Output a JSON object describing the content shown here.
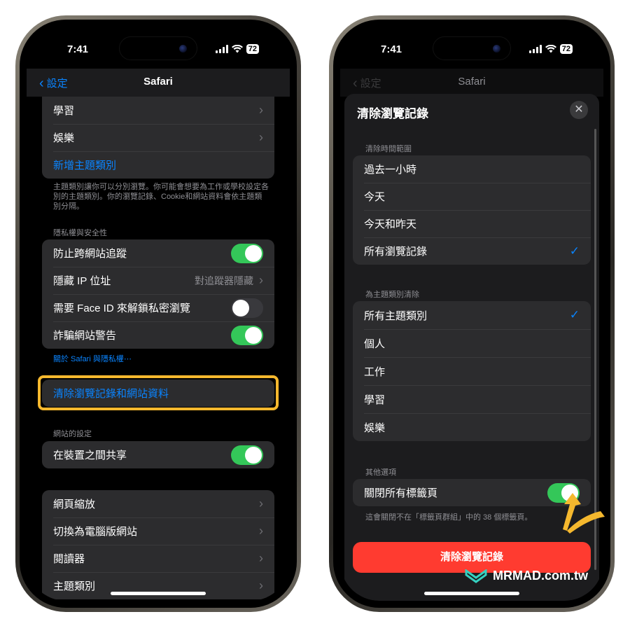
{
  "left": {
    "status": {
      "time": "7:41",
      "battery": "72"
    },
    "nav": {
      "back": "設定",
      "title": "Safari"
    },
    "profiles": [
      {
        "label": "學習"
      },
      {
        "label": "娛樂"
      },
      {
        "label": "新增主題類別"
      }
    ],
    "profiles_footer": "主題類別讓你可以分別瀏覽。你可能會想要為工作或學校設定各別的主題類別。你的瀏覽記錄、Cookie和網站資料會依主題類別分隔。",
    "privacy_header": "隱私權與安全性",
    "privacy": [
      {
        "label": "防止跨網站追蹤",
        "toggle": true
      },
      {
        "label": "隱藏 IP 位址",
        "value": "對追蹤器隱藏"
      },
      {
        "label": "需要 Face ID 來解鎖私密瀏覽",
        "toggle": false
      },
      {
        "label": "詐騙網站警告",
        "toggle": true
      }
    ],
    "privacy_link": "關於 Safari 與隱私權⋯",
    "clear_link": "清除瀏覽記錄和網站資料",
    "website_header": "網站的設定",
    "share_label": "在裝置之間共享",
    "share_toggle": true,
    "bottom_items": [
      {
        "label": "網頁縮放"
      },
      {
        "label": "切換為電腦版網站"
      },
      {
        "label": "閱讀器"
      },
      {
        "label": "主題類別"
      }
    ]
  },
  "right": {
    "status": {
      "time": "7:41",
      "battery": "72"
    },
    "nav": {
      "back": "設定",
      "title": "Safari"
    },
    "sheet_title": "清除瀏覽記錄",
    "range_header": "清除時間範圍",
    "ranges": [
      {
        "label": "過去一小時",
        "checked": false
      },
      {
        "label": "今天",
        "checked": false
      },
      {
        "label": "今天和昨天",
        "checked": false
      },
      {
        "label": "所有瀏覽記錄",
        "checked": true
      }
    ],
    "profile_header": "為主題類別清除",
    "profiles": [
      {
        "label": "所有主題類別",
        "checked": true
      },
      {
        "label": "個人",
        "checked": false
      },
      {
        "label": "工作",
        "checked": false
      },
      {
        "label": "學習",
        "checked": false
      },
      {
        "label": "娛樂",
        "checked": false
      }
    ],
    "other_header": "其他選項",
    "close_tabs_label": "關閉所有標籤頁",
    "close_tabs_toggle": true,
    "close_tabs_footer": "這會關閉不在「標籤頁群組」中的 38 個標籤頁。",
    "clear_button": "清除瀏覽記錄"
  },
  "brand": {
    "name": "MRMAD.com.tw",
    "accent": "#f5b82e"
  }
}
